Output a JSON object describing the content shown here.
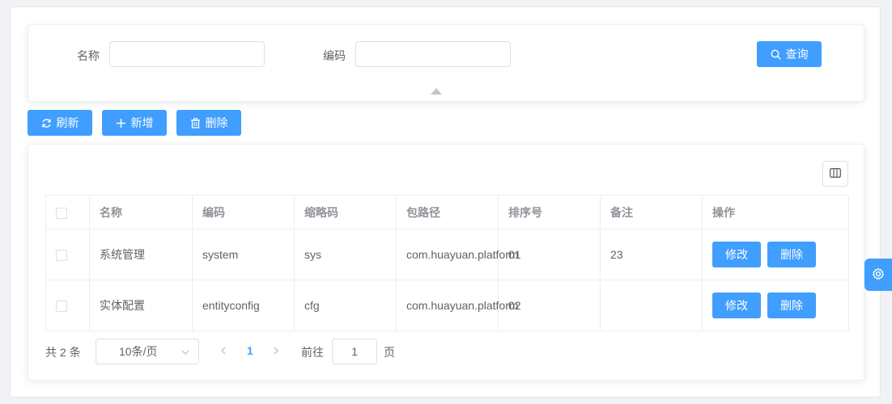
{
  "search": {
    "name_label": "名称",
    "name_value": "",
    "code_label": "编码",
    "code_value": "",
    "query_label": "查询"
  },
  "toolbar": {
    "refresh_label": "刷新",
    "add_label": "新增",
    "delete_label": "删除"
  },
  "table": {
    "headers": [
      "名称",
      "编码",
      "缩略码",
      "包路径",
      "排序号",
      "备注",
      "操作"
    ],
    "rows": [
      {
        "name": "系统管理",
        "code": "system",
        "abbr": "sys",
        "path": "com.huayuan.platform",
        "sort": "01",
        "remark": "23",
        "edit": "修改",
        "del": "删除"
      },
      {
        "name": "实体配置",
        "code": "entityconfig",
        "abbr": "cfg",
        "path": "com.huayuan.platform",
        "sort": "02",
        "remark": "",
        "edit": "修改",
        "del": "删除"
      }
    ]
  },
  "pagination": {
    "total_text": "共 2 条",
    "page_size": "10条/页",
    "current_page": "1",
    "goto_label": "前往",
    "goto_value": "1",
    "page_suffix": "页"
  },
  "icons": {
    "search": "search-icon",
    "refresh": "refresh-icon",
    "add": "plus-icon",
    "delete": "trash-icon",
    "columns": "columns-icon",
    "settings": "gear-icon"
  },
  "colors": {
    "primary": "#409eff",
    "border": "#ebeef5",
    "text": "#606266",
    "header_text": "#909399"
  }
}
